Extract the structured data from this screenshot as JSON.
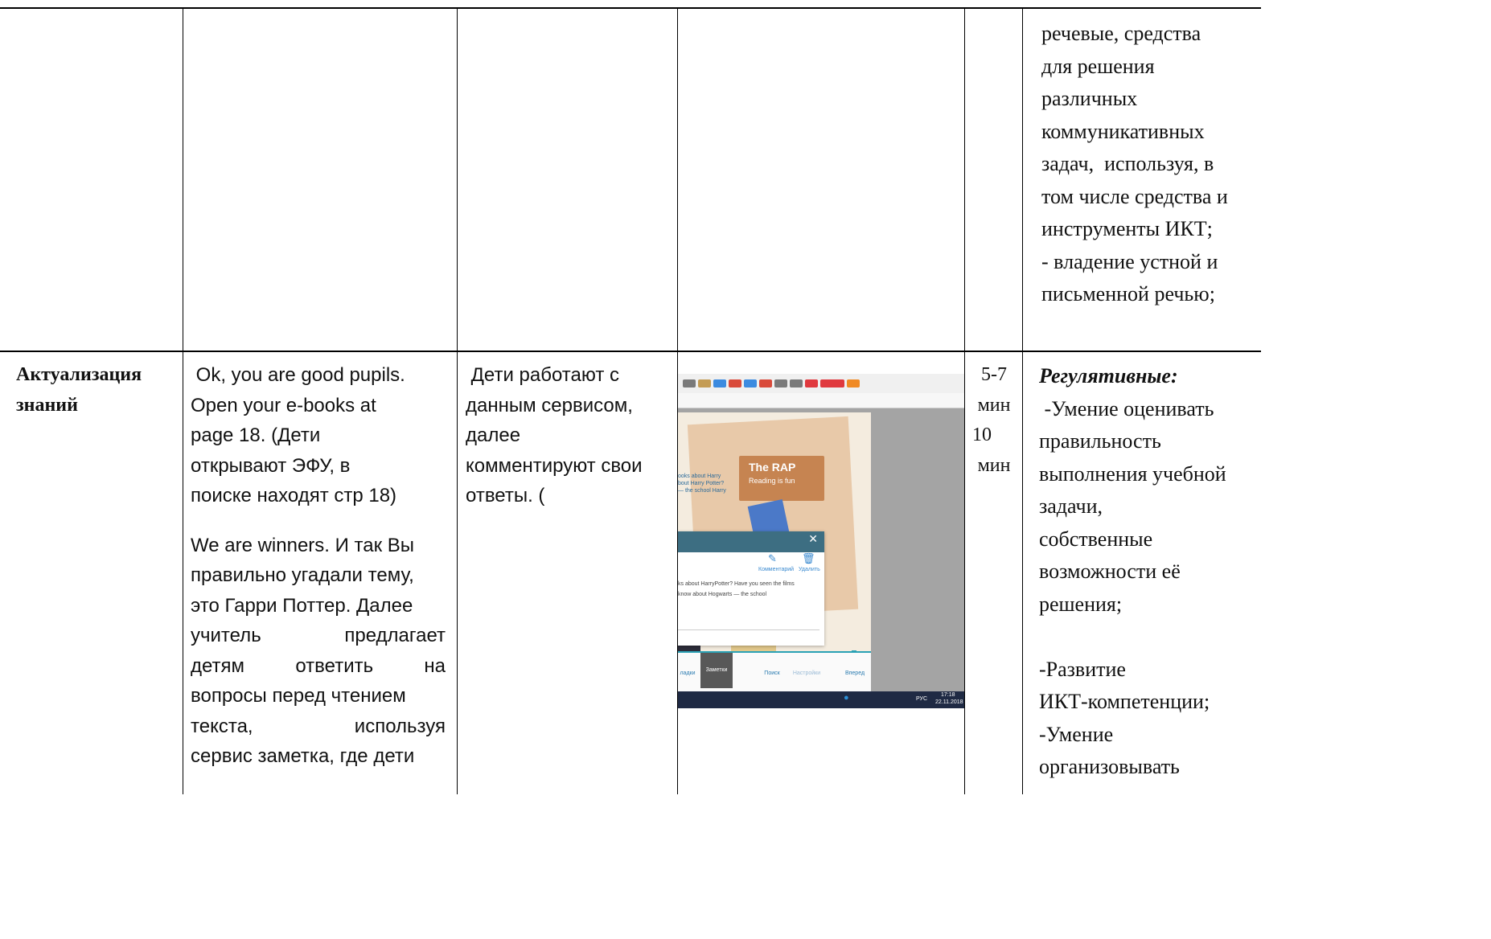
{
  "table": {
    "row1": {
      "col6_lines": [
        "речевые, средства",
        "для решения",
        "различных",
        "коммуникативных",
        "задач,  используя, в",
        "том числе средства и",
        "инструменты ИКТ;",
        "- владение устной и",
        "письменной речью;"
      ]
    },
    "row2": {
      "stage_lines": [
        "Актуализация",
        "знаний"
      ],
      "teacher_p1": [
        " Ok, you are good pupils.",
        "Open your e-books at",
        "page 18. (Дети",
        "открывают ЭФУ, в",
        "поиске находят стр 18)"
      ],
      "teacher_p2": [
        "We are winners. И так Вы",
        "правильно угадали тему,",
        "это Гарри Поттер. Далее",
        "учитель предлагает",
        "детям ответить на",
        "вопросы перед чтением",
        "текста, используя",
        "сервис заметка, где дети"
      ],
      "pupils_lines": [
        " Дети работают с",
        "данным сервисом,",
        "далее",
        "комментируют свои",
        "ответы. ("
      ],
      "time_lines": [
        "5-7",
        "мин",
        "10",
        "мин"
      ],
      "uud_heading": "Регулятивные:",
      "uud_lines": [
        " -Умение оценивать",
        "правильность",
        "выполнения учебной",
        "задачи,",
        "собственные",
        "возможности её",
        "решения;",
        "",
        "-Развитие",
        "ИКТ-компетенции;",
        "-Умение",
        "организовывать"
      ]
    }
  },
  "screenshot": {
    "rap_title": "The RAP",
    "rap_subtitle": "Reading is fun",
    "popup_comment": "Комментарий",
    "popup_delete": "Удалить",
    "popup_text_1": "ks about HarryPotter? Have you seen the films",
    "popup_text_2": "know about Hogwarts — the school",
    "page_text_1": "ooks about Harry",
    "page_text_2": "bout Harry Potter?",
    "page_text_3": "— the school Harry",
    "toolbar_bookmarks": "ладки",
    "toolbar_notes": "Заметки",
    "toolbar_search": "Поиск",
    "toolbar_settings": "Настройки",
    "toolbar_forward": "Вперед",
    "tray_lang": "РУС",
    "tray_time": "17:18",
    "tray_date": "22.11.2018",
    "accent_color": "#2aa1b5",
    "taskbar_color": "#1f2a44"
  }
}
